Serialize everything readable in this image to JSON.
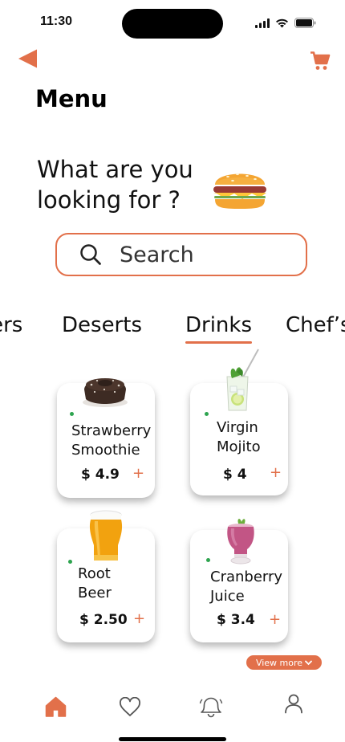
{
  "status_bar": {
    "time": "11:30"
  },
  "header": {
    "title": "Menu"
  },
  "prompt": {
    "line1": "What are you",
    "line2": "looking for ?"
  },
  "search": {
    "placeholder": "Search"
  },
  "tabs": [
    {
      "label": "rers"
    },
    {
      "label": "Deserts"
    },
    {
      "label": "Drinks",
      "active": true
    },
    {
      "label": "Chef’s"
    }
  ],
  "items": [
    {
      "name": "Strawberry\nSmoothie",
      "price": "$ 4.9",
      "image": "chocolate-cake"
    },
    {
      "name": "Virgin\nMojito",
      "price": "$ 4",
      "image": "mojito-glass"
    },
    {
      "name": "Root\nBeer",
      "price": "$ 2.50",
      "image": "beer-glass"
    },
    {
      "name": "Cranberry\nJuice",
      "price": "$ 3.4",
      "image": "cranberry-juice-glass"
    }
  ],
  "add_symbol": "+",
  "view_more": {
    "label": "View more"
  },
  "nav": [
    "home",
    "favorites",
    "notifications",
    "profile"
  ],
  "colors": {
    "accent": "#e2704a",
    "available_dot": "#2ea44f",
    "text": "#111111"
  }
}
